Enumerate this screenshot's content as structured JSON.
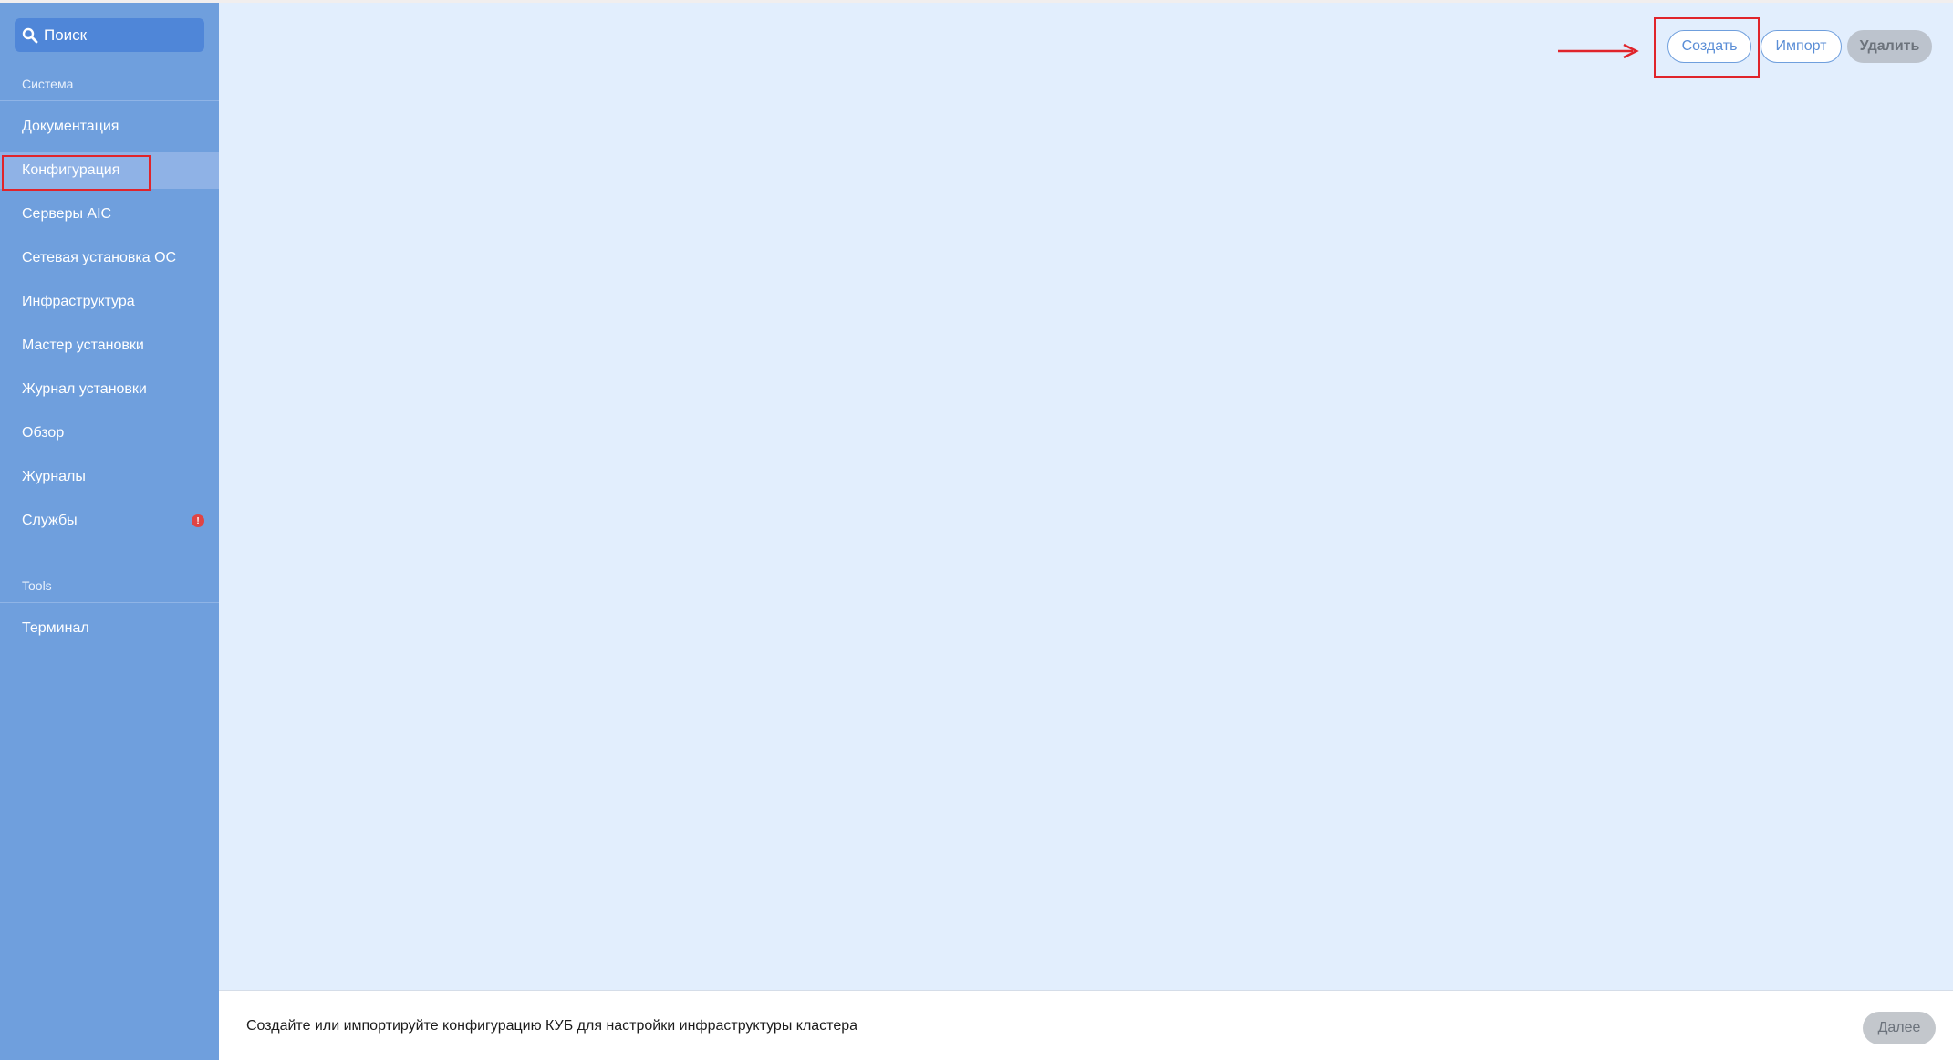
{
  "search": {
    "placeholder": "Поиск"
  },
  "sidebar": {
    "section_system": "Система",
    "items": [
      {
        "label": "Документация"
      },
      {
        "label": "Конфигурация",
        "active": true
      },
      {
        "label": "Серверы AIC"
      },
      {
        "label": "Сетевая установка ОС"
      },
      {
        "label": "Инфраструктура"
      },
      {
        "label": "Мастер установки"
      },
      {
        "label": "Журнал установки"
      },
      {
        "label": "Обзор"
      },
      {
        "label": "Журналы"
      },
      {
        "label": "Службы",
        "badge": "!"
      }
    ],
    "section_tools": "Tools",
    "tools_items": [
      {
        "label": "Терминал"
      }
    ]
  },
  "toolbar": {
    "create_label": "Создать",
    "import_label": "Импорт",
    "delete_label": "Удалить"
  },
  "footer": {
    "message": "Создайте или импортируйте конфигурацию КУБ для настройки инфраструктуры кластера",
    "next_label": "Далее"
  },
  "colors": {
    "sidebar_bg": "#6f9fdd",
    "main_bg": "#e2eefd",
    "accent": "#5b8ed6",
    "highlight": "#e0242b",
    "badge": "#e04444"
  }
}
